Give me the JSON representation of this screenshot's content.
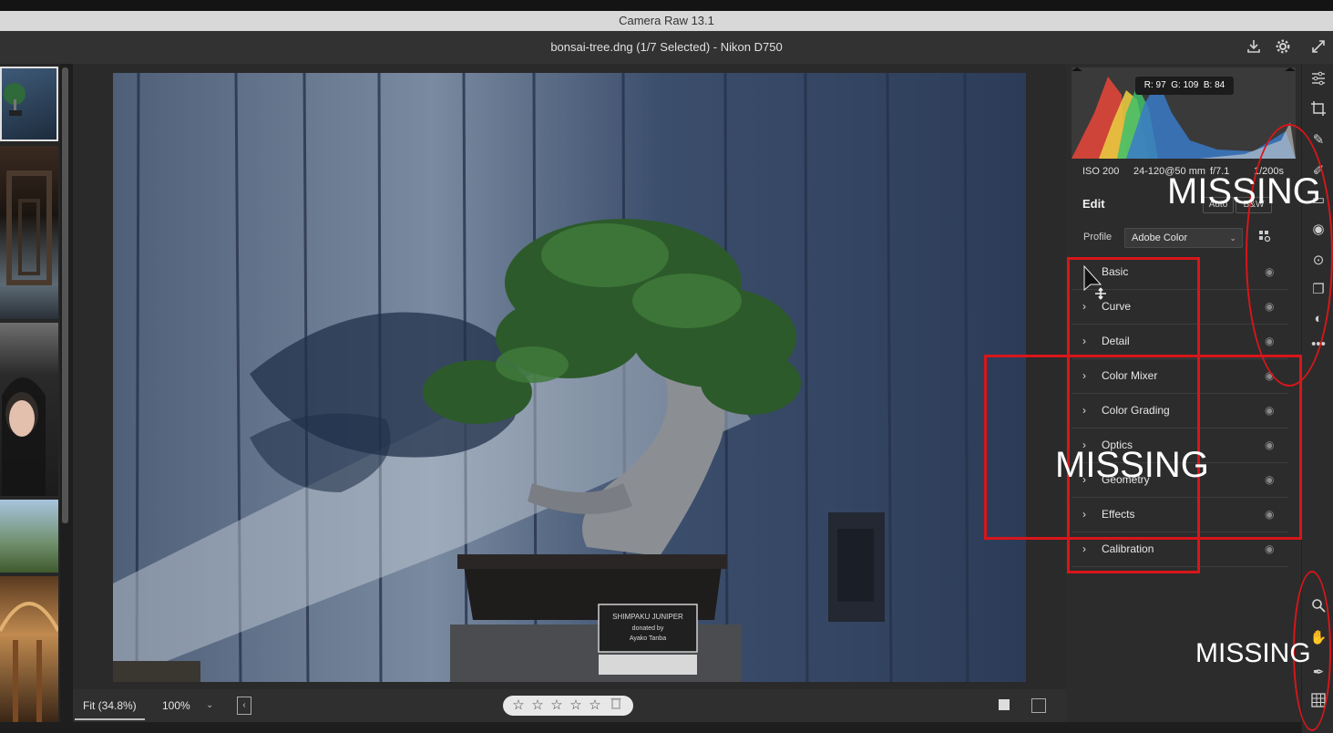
{
  "window": {
    "title": "Camera Raw 13.1"
  },
  "header": {
    "file_name": "bonsai-tree.dng (1/7 Selected)  -  Nikon D750",
    "save_icon": "download-icon",
    "settings_icon": "gear-icon",
    "fullscreen_icon": "expand-icon"
  },
  "photo": {
    "plaque_line1": "SHIMPAKU JUNIPER",
    "plaque_line2": "donated by",
    "plaque_line3": "Ayako Tanba"
  },
  "bottom_bar": {
    "fit_label": "Fit (34.8%)",
    "zoom_label": "100%",
    "stars": [
      "☆",
      "☆",
      "☆",
      "☆",
      "☆"
    ]
  },
  "histogram": {
    "readout": {
      "r": "R: 97",
      "g": "G: 109",
      "b": "B: 84"
    }
  },
  "exif": {
    "iso": "ISO 200",
    "lens": "24-120@50 mm",
    "aperture": "f/7.1",
    "shutter": "1/200s"
  },
  "edit_panel": {
    "title": "Edit",
    "auto_label": "Auto",
    "bw_label": "B&W",
    "profile_label": "Profile",
    "profile_value": "Adobe Color",
    "sections": [
      {
        "label": "Basic"
      },
      {
        "label": "Curve"
      },
      {
        "label": "Detail"
      },
      {
        "label": "Color Mixer"
      },
      {
        "label": "Color Grading"
      },
      {
        "label": "Optics"
      },
      {
        "label": "Geometry"
      },
      {
        "label": "Effects"
      },
      {
        "label": "Calibration"
      }
    ]
  },
  "tools": {
    "top": [
      "sliders-icon",
      "crop-icon",
      "healing-icon",
      "brush-icon",
      "gradient-icon",
      "radial-icon",
      "red-eye-icon",
      "snapshots-icon",
      "presets-icon",
      "more-icon"
    ],
    "bottom": [
      "zoom-icon",
      "hand-icon",
      "sampler-icon",
      "grid-icon"
    ]
  },
  "annotations": {
    "missing_top": "MISSING",
    "missing_middle": "MISSING",
    "missing_bottom": "MISSING",
    "color": "#d8161a"
  }
}
